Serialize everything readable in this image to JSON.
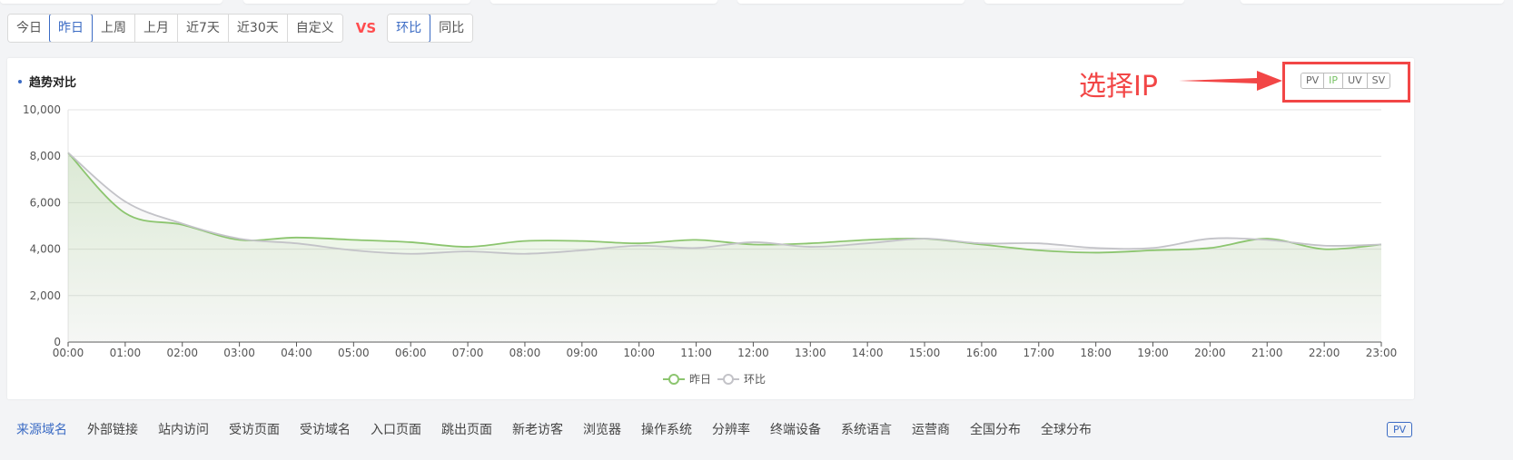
{
  "toolbar": {
    "date_ranges": [
      "今日",
      "昨日",
      "上周",
      "上月",
      "近7天",
      "近30天",
      "自定义"
    ],
    "active_date_range": "昨日",
    "vs_label": "VS",
    "compare_modes": [
      "环比",
      "同比"
    ],
    "active_compare_mode": "环比"
  },
  "chart_card": {
    "title": "趋势对比",
    "metrics": [
      "PV",
      "IP",
      "UV",
      "SV"
    ],
    "active_metric": "IP",
    "annotation": "选择IP"
  },
  "chart_data": {
    "type": "area",
    "x": [
      "00:00",
      "01:00",
      "02:00",
      "03:00",
      "04:00",
      "05:00",
      "06:00",
      "07:00",
      "08:00",
      "09:00",
      "10:00",
      "11:00",
      "12:00",
      "13:00",
      "14:00",
      "15:00",
      "16:00",
      "17:00",
      "18:00",
      "19:00",
      "20:00",
      "21:00",
      "22:00",
      "23:00"
    ],
    "ylim": [
      0,
      10000
    ],
    "yticks": [
      "0",
      "2,000",
      "4,000",
      "6,000",
      "8,000",
      "10,000"
    ],
    "series": [
      {
        "name": "昨日",
        "color": "#8cc56f",
        "values": [
          8150,
          5550,
          5050,
          4400,
          4500,
          4400,
          4300,
          4100,
          4350,
          4350,
          4250,
          4400,
          4200,
          4250,
          4400,
          4450,
          4200,
          3950,
          3850,
          3950,
          4050,
          4450,
          4000,
          4200
        ]
      },
      {
        "name": "环比",
        "color": "#c3c3c8",
        "values": [
          8150,
          6050,
          5100,
          4450,
          4250,
          3950,
          3800,
          3900,
          3800,
          3950,
          4150,
          4050,
          4300,
          4100,
          4250,
          4450,
          4250,
          4250,
          4050,
          4050,
          4450,
          4400,
          4150,
          4200
        ]
      }
    ],
    "grid": true,
    "legend_position": "bottom-center"
  },
  "bottom_tabs": {
    "items": [
      "来源域名",
      "外部链接",
      "站内访问",
      "受访页面",
      "受访域名",
      "入口页面",
      "跳出页面",
      "新老访客",
      "浏览器",
      "操作系统",
      "分辨率",
      "终端设备",
      "系统语言",
      "运营商",
      "全国分布",
      "全球分布"
    ],
    "active": "来源域名",
    "badge": "PV"
  }
}
